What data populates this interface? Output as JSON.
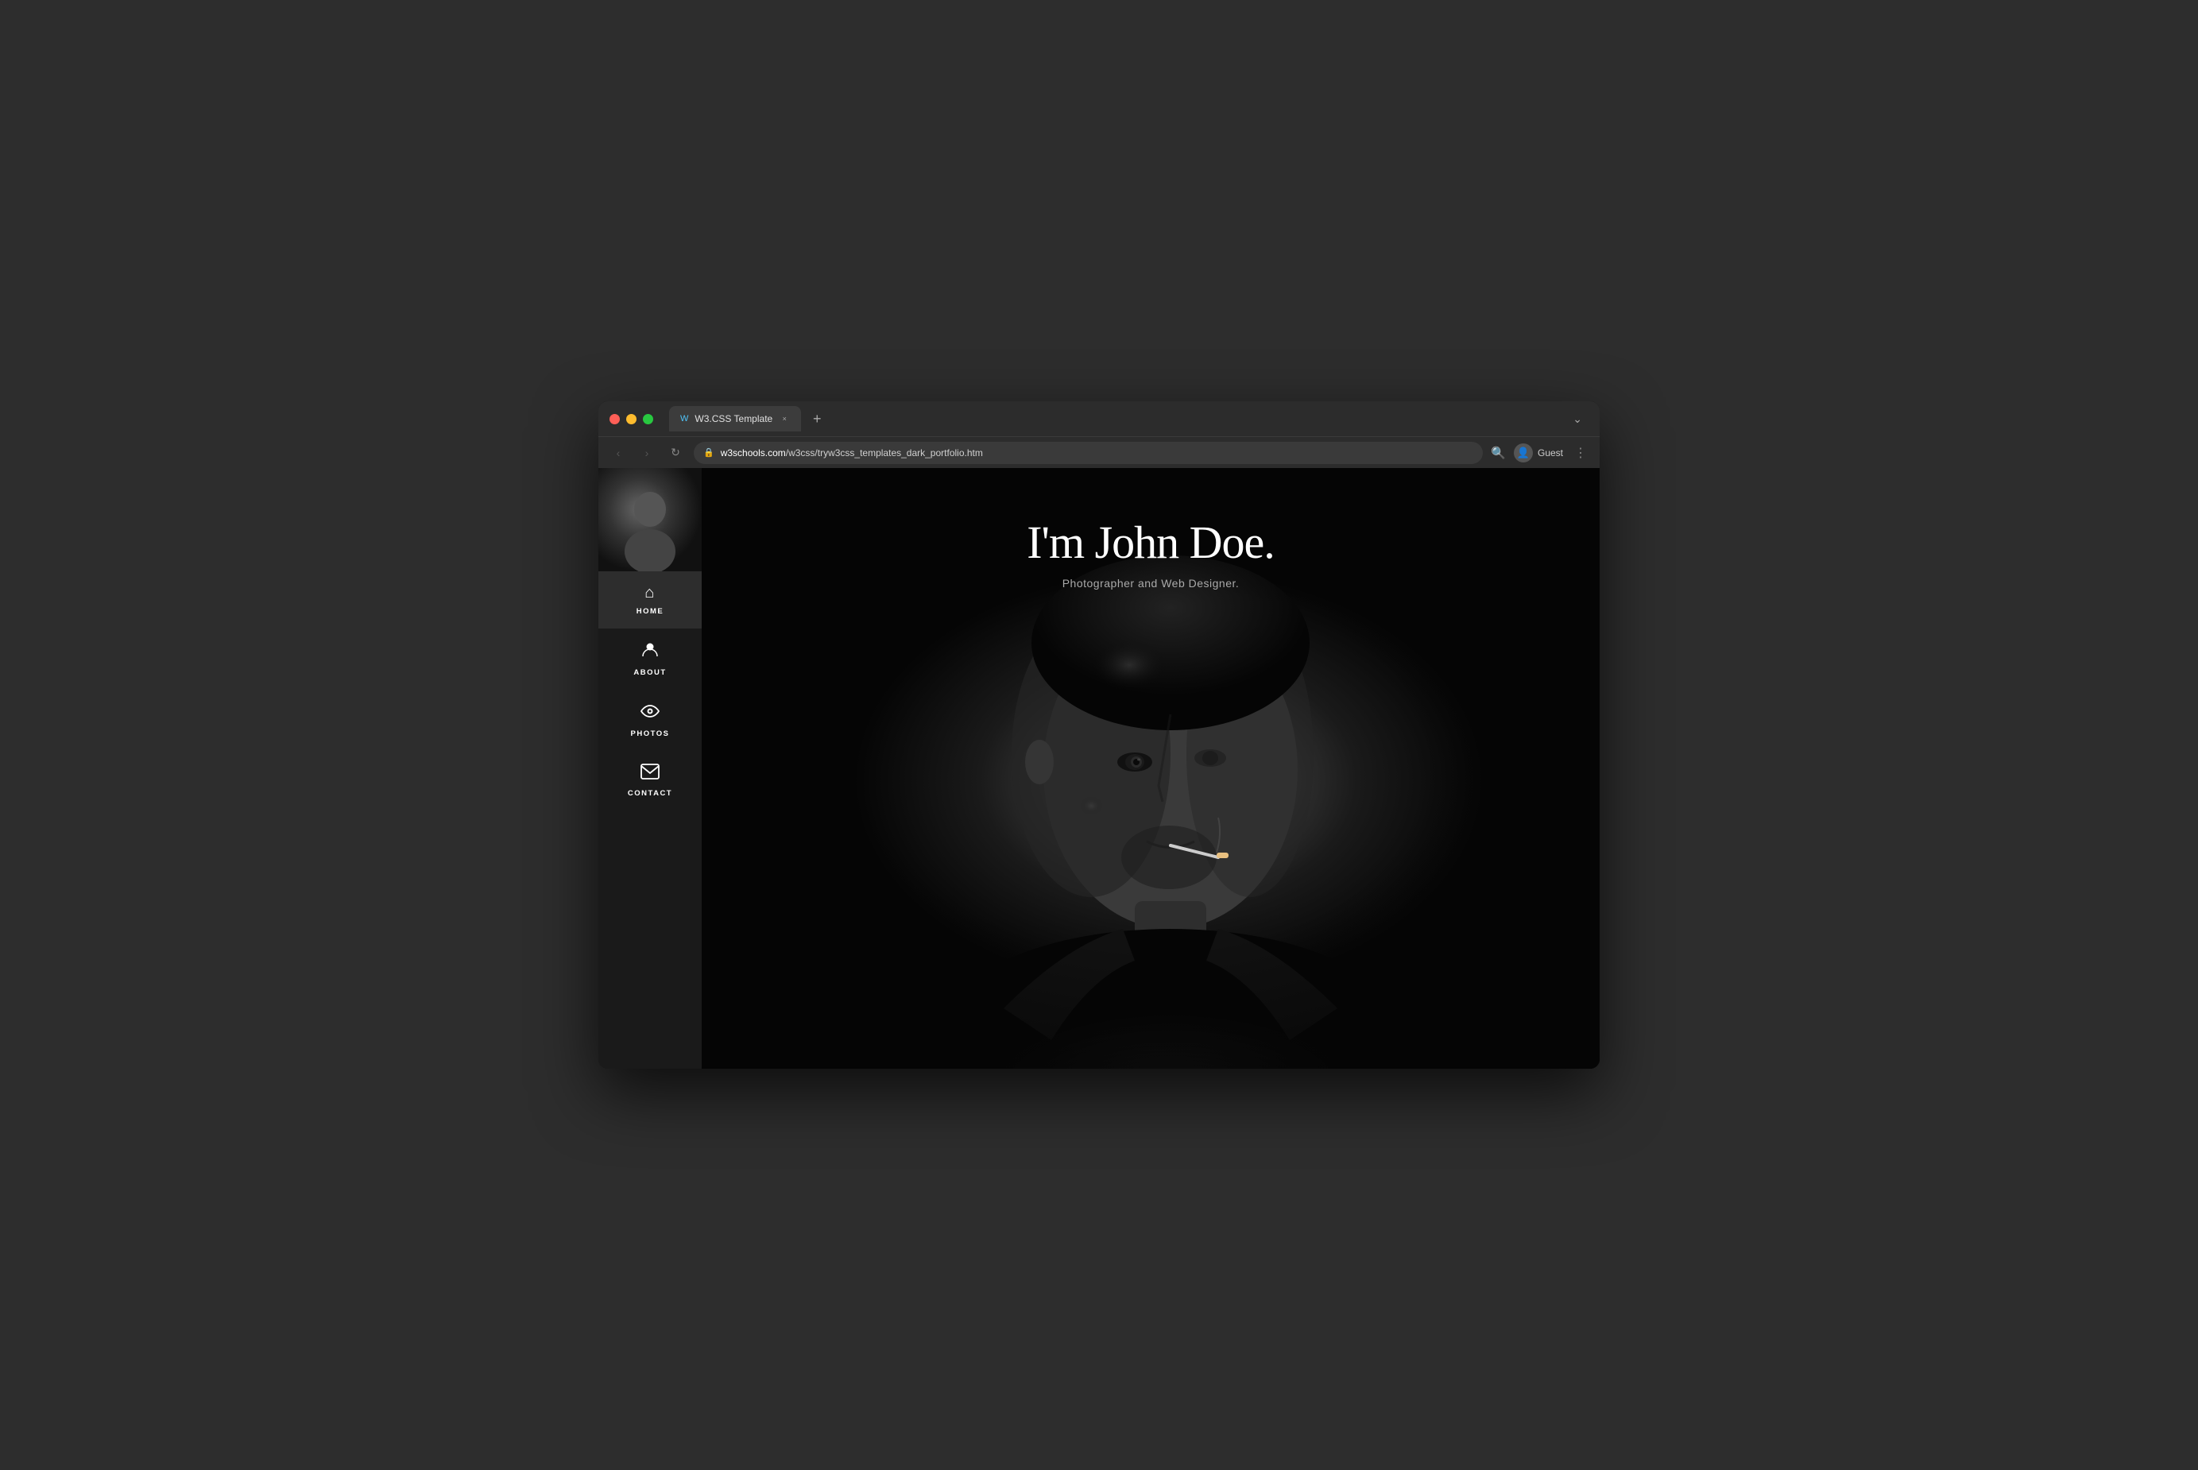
{
  "browser": {
    "tab_favicon": "W",
    "tab_title": "W3.CSS Template",
    "tab_close_label": "×",
    "tab_new_label": "+",
    "tab_more_label": "⌄",
    "nav_back": "‹",
    "nav_forward": "›",
    "nav_refresh": "↻",
    "url_lock": "🔒",
    "url_domain": "w3schools.com",
    "url_path": "/w3css/tryw3css_templates_dark_portfolio.htm",
    "search_icon": "🔍",
    "avatar_icon": "👤",
    "avatar_label": "Guest",
    "more_icon": "⋮"
  },
  "sidebar": {
    "nav_items": [
      {
        "id": "home",
        "label": "HOME",
        "icon": "⌂"
      },
      {
        "id": "about",
        "label": "ABOUT",
        "icon": "👤"
      },
      {
        "id": "photos",
        "label": "PHOTOS",
        "icon": "👁"
      },
      {
        "id": "contact",
        "label": "CONTACT",
        "icon": "✉"
      }
    ]
  },
  "hero": {
    "title": "I'm John Doe.",
    "subtitle": "Photographer and Web Designer."
  }
}
